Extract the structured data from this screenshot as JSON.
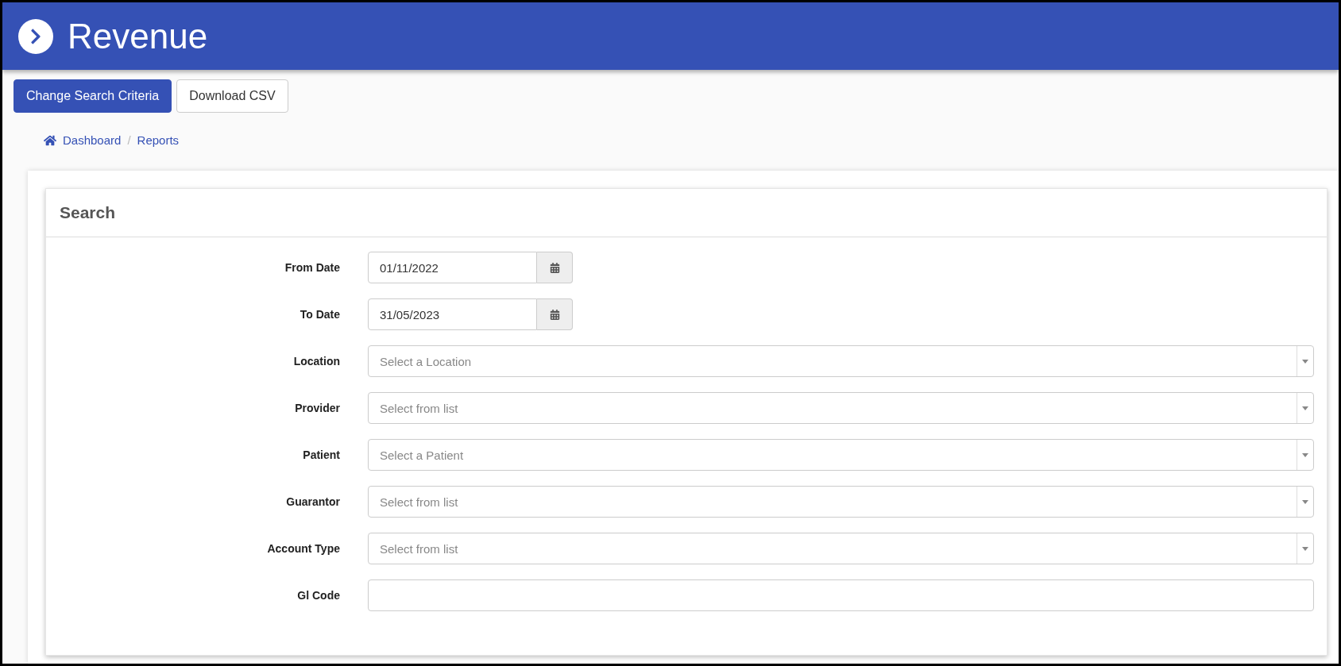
{
  "header": {
    "title": "Revenue"
  },
  "actions": [
    {
      "label": "Change Search Criteria",
      "kind": "primary"
    },
    {
      "label": "Download CSV",
      "kind": "default"
    }
  ],
  "breadcrumb_separator": "/",
  "breadcrumb": [
    {
      "label": "Dashboard",
      "kind": "home"
    },
    {
      "label": "Reports",
      "kind": "link"
    }
  ],
  "search": {
    "title": "Search",
    "fields": [
      {
        "label": "From Date",
        "kind": "date",
        "value": "01/11/2022"
      },
      {
        "label": "To Date",
        "kind": "date",
        "value": "31/05/2023"
      },
      {
        "label": "Location",
        "kind": "select",
        "placeholder": "Select a Location"
      },
      {
        "label": "Provider",
        "kind": "select",
        "placeholder": "Select from list"
      },
      {
        "label": "Patient",
        "kind": "select",
        "placeholder": "Select a Patient"
      },
      {
        "label": "Guarantor",
        "kind": "select",
        "placeholder": "Select from list"
      },
      {
        "label": "Account Type",
        "kind": "select",
        "placeholder": "Select from list"
      },
      {
        "label": "Gl Code",
        "kind": "text"
      }
    ]
  }
}
